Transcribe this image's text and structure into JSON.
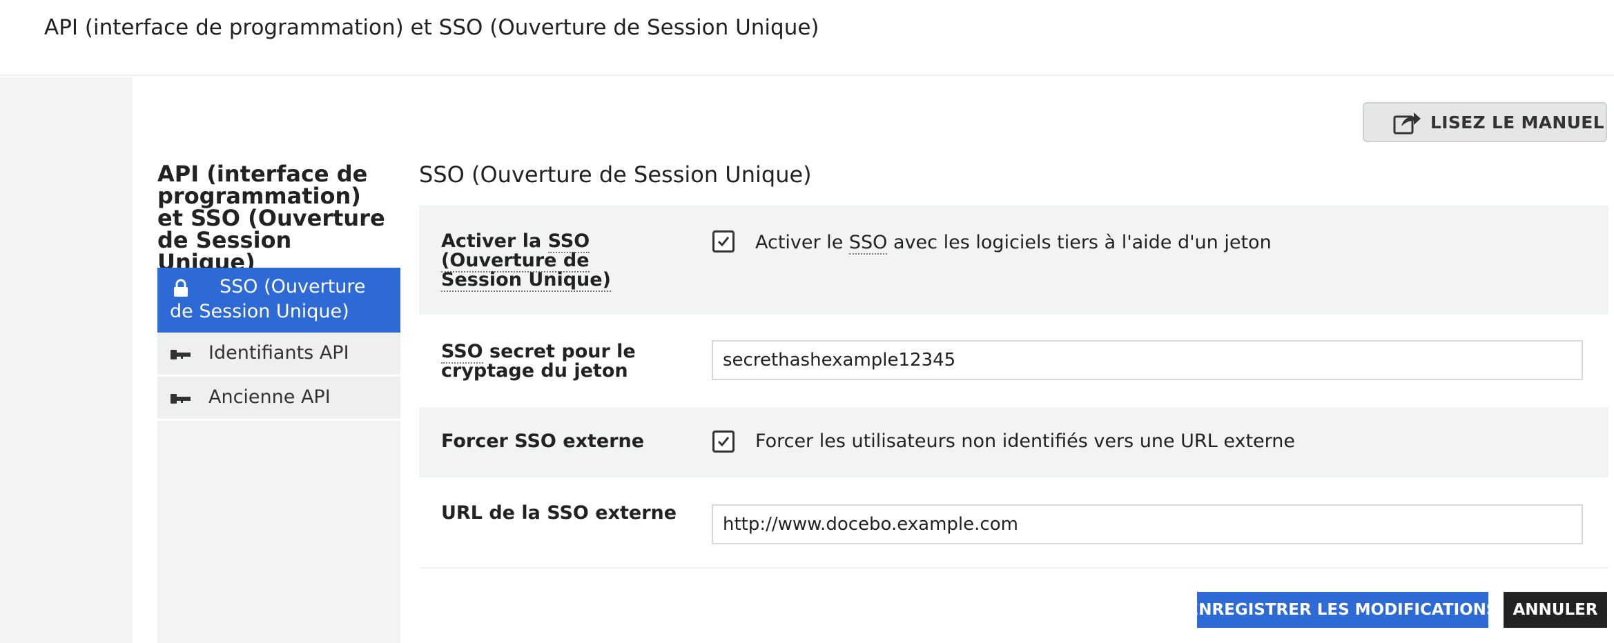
{
  "header": {
    "title": "API (interface de programmation) et SSO (Ouverture de Session Unique)"
  },
  "manual_button": {
    "label": "LISEZ LE MANUEL",
    "icon": "share-icon"
  },
  "sidebar": {
    "title": "API (interface de programmation) et SSO (Ouverture de Session Unique)",
    "items": [
      {
        "label": "SSO (Ouverture de Session Unique)",
        "icon": "lock-icon",
        "active": true
      },
      {
        "label": "Identifiants API",
        "icon": "key-icon",
        "active": false
      },
      {
        "label": "Ancienne API",
        "icon": "key-icon",
        "active": false
      }
    ]
  },
  "section": {
    "title": "SSO (Ouverture de Session Unique)",
    "enable_sso": {
      "label_prefix": "Activer la ",
      "label_abbr": "SSO",
      "label_suffix": "(Ouverture de Session Unique)",
      "checkbox_prefix": "Activer le ",
      "checkbox_abbr": "SSO",
      "checkbox_suffix": " avec les logiciels tiers à l'aide d'un jeton",
      "checked": true
    },
    "sso_secret": {
      "label_abbr": "SSO",
      "label_suffix": " secret pour le cryptage du jeton",
      "value": "secrethashexample12345"
    },
    "force_external": {
      "label": "Forcer SSO externe",
      "checkbox_label": "Forcer les utilisateurs non identifiés vers une URL externe",
      "checked": true
    },
    "external_url": {
      "label": "URL de la SSO externe",
      "value": "http://www.docebo.example.com"
    }
  },
  "actions": {
    "save_label": "ENREGISTRER LES MODIFICATIONS",
    "cancel_label": "ANNULER"
  },
  "colors": {
    "accent": "#2d6ad6",
    "cancel": "#222222",
    "panel_gray": "#f2f3f3"
  }
}
